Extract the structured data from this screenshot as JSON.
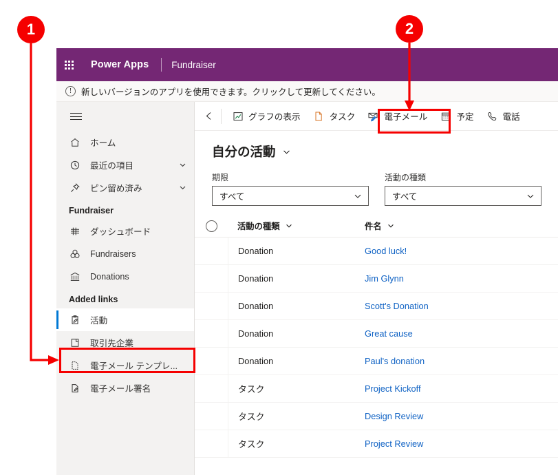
{
  "header": {
    "waffle_icon": "waffle-grid-icon",
    "brand": "Power Apps",
    "app_name": "Fundraiser",
    "brand_color": "#742774"
  },
  "notification": {
    "icon": "exclamation-circle-icon",
    "text": "新しいバージョンのアプリを使用できます。クリックして更新してください。"
  },
  "sidebar": {
    "hamburger_icon": "hamburger-menu-icon",
    "items": [
      {
        "label": "ホーム",
        "icon": "home-icon",
        "chevron": false,
        "selected": false
      },
      {
        "label": "最近の項目",
        "icon": "clock-icon",
        "chevron": true,
        "selected": false
      },
      {
        "label": "ピン留め済み",
        "icon": "pin-icon",
        "chevron": true,
        "selected": false
      }
    ],
    "group1": {
      "title": "Fundraiser",
      "items": [
        {
          "label": "ダッシュボード",
          "icon": "dashboard-icon",
          "selected": false
        },
        {
          "label": "Fundraisers",
          "icon": "coins-icon",
          "selected": false
        },
        {
          "label": "Donations",
          "icon": "bank-icon",
          "selected": false
        }
      ]
    },
    "group2": {
      "title": "Added links",
      "items": [
        {
          "label": "活動",
          "icon": "clipboard-pencil-icon",
          "selected": true
        },
        {
          "label": "取引先企業",
          "icon": "company-icon",
          "selected": false
        },
        {
          "label": "電子メール テンプレ...",
          "icon": "template-icon",
          "selected": false
        },
        {
          "label": "電子メール署名",
          "icon": "signature-icon",
          "selected": false
        }
      ]
    }
  },
  "commandbar": {
    "back_icon": "back-arrow-icon",
    "buttons": [
      {
        "label": "グラフの表示",
        "icon": "chart-icon",
        "highlighted": false
      },
      {
        "label": "タスク",
        "icon": "task-page-icon",
        "highlighted": false
      },
      {
        "label": "電子メール",
        "icon": "email-icon",
        "highlighted": true
      },
      {
        "label": "予定",
        "icon": "calendar-icon",
        "highlighted": false
      },
      {
        "label": "電話",
        "icon": "phone-icon",
        "highlighted": false
      }
    ]
  },
  "view": {
    "title": "自分の活動",
    "title_chevron_icon": "chevron-down-icon"
  },
  "filters": [
    {
      "label": "期限",
      "value": "すべて",
      "chevron_icon": "chevron-down-icon"
    },
    {
      "label": "活動の種類",
      "value": "すべて",
      "chevron_icon": "chevron-down-icon"
    }
  ],
  "grid": {
    "select_all_icon": "select-all-circle-icon",
    "columns": [
      {
        "label": "活動の種類",
        "sort_icon": "chevron-down-icon"
      },
      {
        "label": "件名",
        "sort_icon": "chevron-down-icon"
      }
    ],
    "rows": [
      {
        "type": "Donation",
        "subject": "Good luck!"
      },
      {
        "type": "Donation",
        "subject": "Jim Glynn"
      },
      {
        "type": "Donation",
        "subject": "Scott's Donation"
      },
      {
        "type": "Donation",
        "subject": "Great cause"
      },
      {
        "type": "Donation",
        "subject": "Paul's donation"
      },
      {
        "type": "タスク",
        "subject": "Project Kickoff"
      },
      {
        "type": "タスク",
        "subject": "Design Review"
      },
      {
        "type": "タスク",
        "subject": "Project Review"
      }
    ]
  },
  "annotations": {
    "marker1": "1",
    "marker2": "2",
    "color": "#f50000"
  }
}
